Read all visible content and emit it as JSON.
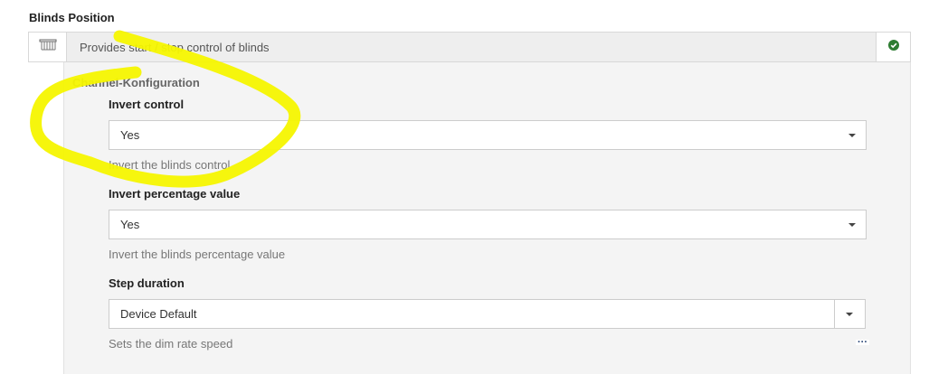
{
  "section": {
    "title": "Blinds Position"
  },
  "channel": {
    "icon": "blinds-icon",
    "description": "Provides start / stop control of blinds",
    "status_icon": "check-circle-icon",
    "status_color": "#2e7d32"
  },
  "config": {
    "heading": "Channel-Konfiguration",
    "fields": [
      {
        "label": "Invert control",
        "value": "Yes",
        "help": "Invert the blinds control"
      },
      {
        "label": "Invert percentage value",
        "value": "Yes",
        "help": "Invert the blinds percentage value"
      },
      {
        "label": "Step duration",
        "value": "Device Default",
        "help": "Sets the dim rate speed"
      }
    ]
  },
  "annotation": {
    "color": "#f6f600"
  },
  "more_icon": "ellipsis-icon"
}
